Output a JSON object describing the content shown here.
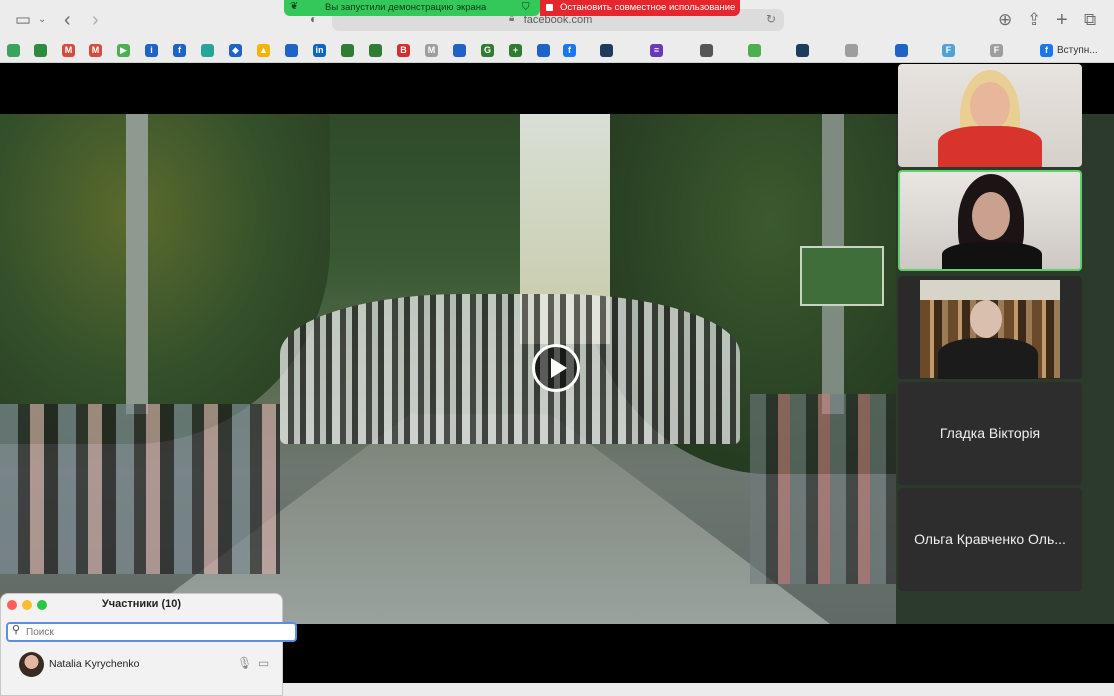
{
  "browser": {
    "url": "facebook.com",
    "share_banner": "Вы запустили демонстрацию экрана",
    "stop_banner": "Остановить совместное использование",
    "last_bookmark": "Вступн..."
  },
  "icons": {
    "sidebar": "sidebar-icon",
    "back": "chevron-left-icon",
    "forward": "chevron-right-icon",
    "download": "download-icon",
    "share": "share-icon",
    "new_tab": "plus-icon",
    "tabs": "tabs-icon",
    "play": "play-icon",
    "mic": "microphone-icon",
    "cam": "camera-icon",
    "search": "search-icon"
  },
  "colors": {
    "share_green": "#34c759",
    "stop_red": "#e5262d",
    "active_speaker": "#5fd16a"
  },
  "bookmarks": [
    {
      "color": "#3aa55a",
      "glyph": ""
    },
    {
      "color": "#2e8b3d",
      "glyph": ""
    },
    {
      "color": "#d54b3d",
      "glyph": "M"
    },
    {
      "color": "#d54b3d",
      "glyph": "M"
    },
    {
      "color": "#4caf50",
      "glyph": "▶"
    },
    {
      "color": "#1e63c5",
      "glyph": "i"
    },
    {
      "color": "#1e63c5",
      "glyph": "f"
    },
    {
      "color": "#26a69a",
      "glyph": ""
    },
    {
      "color": "#1e63c5",
      "glyph": "◆"
    },
    {
      "color": "#f4b400",
      "glyph": "▲"
    },
    {
      "color": "#1e63c5",
      "glyph": ""
    },
    {
      "color": "#0a66c2",
      "glyph": "in"
    },
    {
      "color": "#2e7d32",
      "glyph": ""
    },
    {
      "color": "#2e7d32",
      "glyph": ""
    },
    {
      "color": "#d32f2f",
      "glyph": "B"
    },
    {
      "color": "#9e9e9e",
      "glyph": "M"
    },
    {
      "color": "#1e63c5",
      "glyph": ""
    },
    {
      "color": "#2e7d32",
      "glyph": "G"
    },
    {
      "color": "#2e7d32",
      "glyph": "+"
    },
    {
      "color": "#1e63c5",
      "glyph": ""
    },
    {
      "color": "#1877f2",
      "glyph": "f"
    },
    {
      "color": "#1e3a5f",
      "glyph": ""
    },
    {
      "color": "#6a3ab5",
      "glyph": "≡"
    },
    {
      "color": "#555555",
      "glyph": ""
    },
    {
      "color": "#4caf50",
      "glyph": ""
    },
    {
      "color": "#1e3a5f",
      "glyph": ""
    },
    {
      "color": "#9e9e9e",
      "glyph": ""
    },
    {
      "color": "#1e63c5",
      "glyph": ""
    },
    {
      "color": "#4fa3d9",
      "glyph": "F"
    },
    {
      "color": "#9e9e9e",
      "glyph": "F"
    },
    {
      "color": "#1877f2",
      "glyph": "f"
    }
  ],
  "participants_panel": {
    "title": "Участники (10)",
    "search_placeholder": "Поиск",
    "first_participant": "Natalia Kyrychenko"
  },
  "tiles": {
    "tile4_name": "Гладка Вікторія",
    "tile5_name": "Ольга Кравченко Оль..."
  }
}
